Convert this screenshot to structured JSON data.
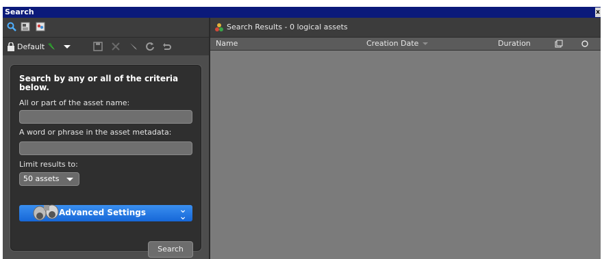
{
  "window": {
    "title": "Search",
    "close_label": "x"
  },
  "left_panel": {
    "tabs": [
      {
        "icon": "search-icon"
      },
      {
        "icon": "asset-list-icon"
      },
      {
        "icon": "image-browser-icon"
      }
    ],
    "preset": {
      "label": "Default"
    },
    "toolbar_icons": [
      "save-icon",
      "delete-icon",
      "pin-icon",
      "refresh-icon",
      "undo-icon"
    ],
    "form": {
      "heading": "Search by any or all of the criteria below.",
      "name_label": "All or part of the asset name:",
      "name_value": "",
      "metadata_label": "A word or phrase in the asset metadata:",
      "metadata_value": "",
      "limit_label": "Limit results to:",
      "limit_value": "50 assets",
      "advanced_label": "Advanced Settings"
    },
    "search_button": "Search"
  },
  "results": {
    "title": "Search Results - 0 logical assets",
    "columns": [
      "Name",
      "Creation Date",
      "Duration"
    ],
    "rows": []
  },
  "colors": {
    "title_bar": "#0b1a7a",
    "accent_blue": "#1f73e0",
    "panel_bg": "#4d4d4d"
  }
}
